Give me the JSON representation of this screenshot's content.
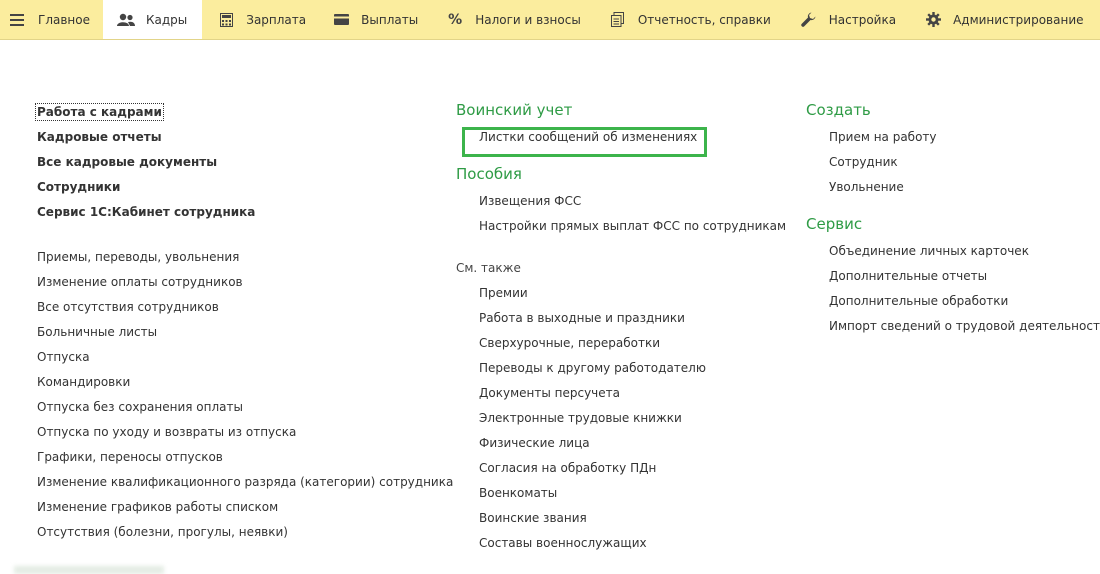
{
  "menu": {
    "tabs": [
      {
        "label": "Главное",
        "icon": "hamburger-icon"
      },
      {
        "label": "Кадры",
        "icon": "people-icon",
        "active": true
      },
      {
        "label": "Зарплата",
        "icon": "calculator-icon"
      },
      {
        "label": "Выплаты",
        "icon": "card-icon"
      },
      {
        "label": "Налоги и взносы",
        "icon": "percent-icon"
      },
      {
        "label": "Отчетность, справки",
        "icon": "report-icon"
      },
      {
        "label": "Настройка",
        "icon": "wrench-icon"
      },
      {
        "label": "Администрирование",
        "icon": "gear-icon"
      }
    ]
  },
  "col1": {
    "bold": [
      "Работа с кадрами",
      "Кадровые отчеты",
      "Все кадровые документы",
      "Сотрудники",
      "Сервис 1С:Кабинет сотрудника"
    ],
    "links": [
      "Приемы, переводы, увольнения",
      "Изменение оплаты сотрудников",
      "Все отсутствия сотрудников",
      "Больничные листы",
      "Отпуска",
      "Командировки",
      "Отпуска без сохранения оплаты",
      "Отпуска по уходу и возвраты из отпуска",
      "Графики, переносы отпусков",
      "Изменение квалификационного разряда (категории) сотрудника",
      "Изменение графиков работы списком",
      "Отсутствия (болезни, прогулы, неявки)"
    ]
  },
  "col2": {
    "military": {
      "title": "Воинский учет",
      "links": [
        "Листки сообщений об изменениях"
      ]
    },
    "benefits": {
      "title": "Пособия",
      "links": [
        "Извещения ФСС",
        "Настройки прямых выплат ФСС по сотрудникам"
      ]
    },
    "see_also": {
      "title": "См. также",
      "links": [
        "Премии",
        "Работа в выходные и праздники",
        "Сверхурочные, переработки",
        "Переводы к другому работодателю",
        "Документы персучета",
        "Электронные трудовые книжки",
        "Физические лица",
        "Согласия на обработку ПДн",
        "Военкоматы",
        "Воинские звания",
        "Составы военнослужащих"
      ]
    }
  },
  "col3": {
    "create": {
      "title": "Создать",
      "links": [
        "Прием на работу",
        "Сотрудник",
        "Увольнение"
      ]
    },
    "service": {
      "title": "Сервис",
      "links": [
        "Объединение личных карточек",
        "Дополнительные отчеты",
        "Дополнительные обработки",
        "Импорт сведений о трудовой деятельности"
      ]
    }
  },
  "colors": {
    "menu_bg": "#fbed9e",
    "section_title": "#2e9b45",
    "highlight": "#3cb44b"
  }
}
